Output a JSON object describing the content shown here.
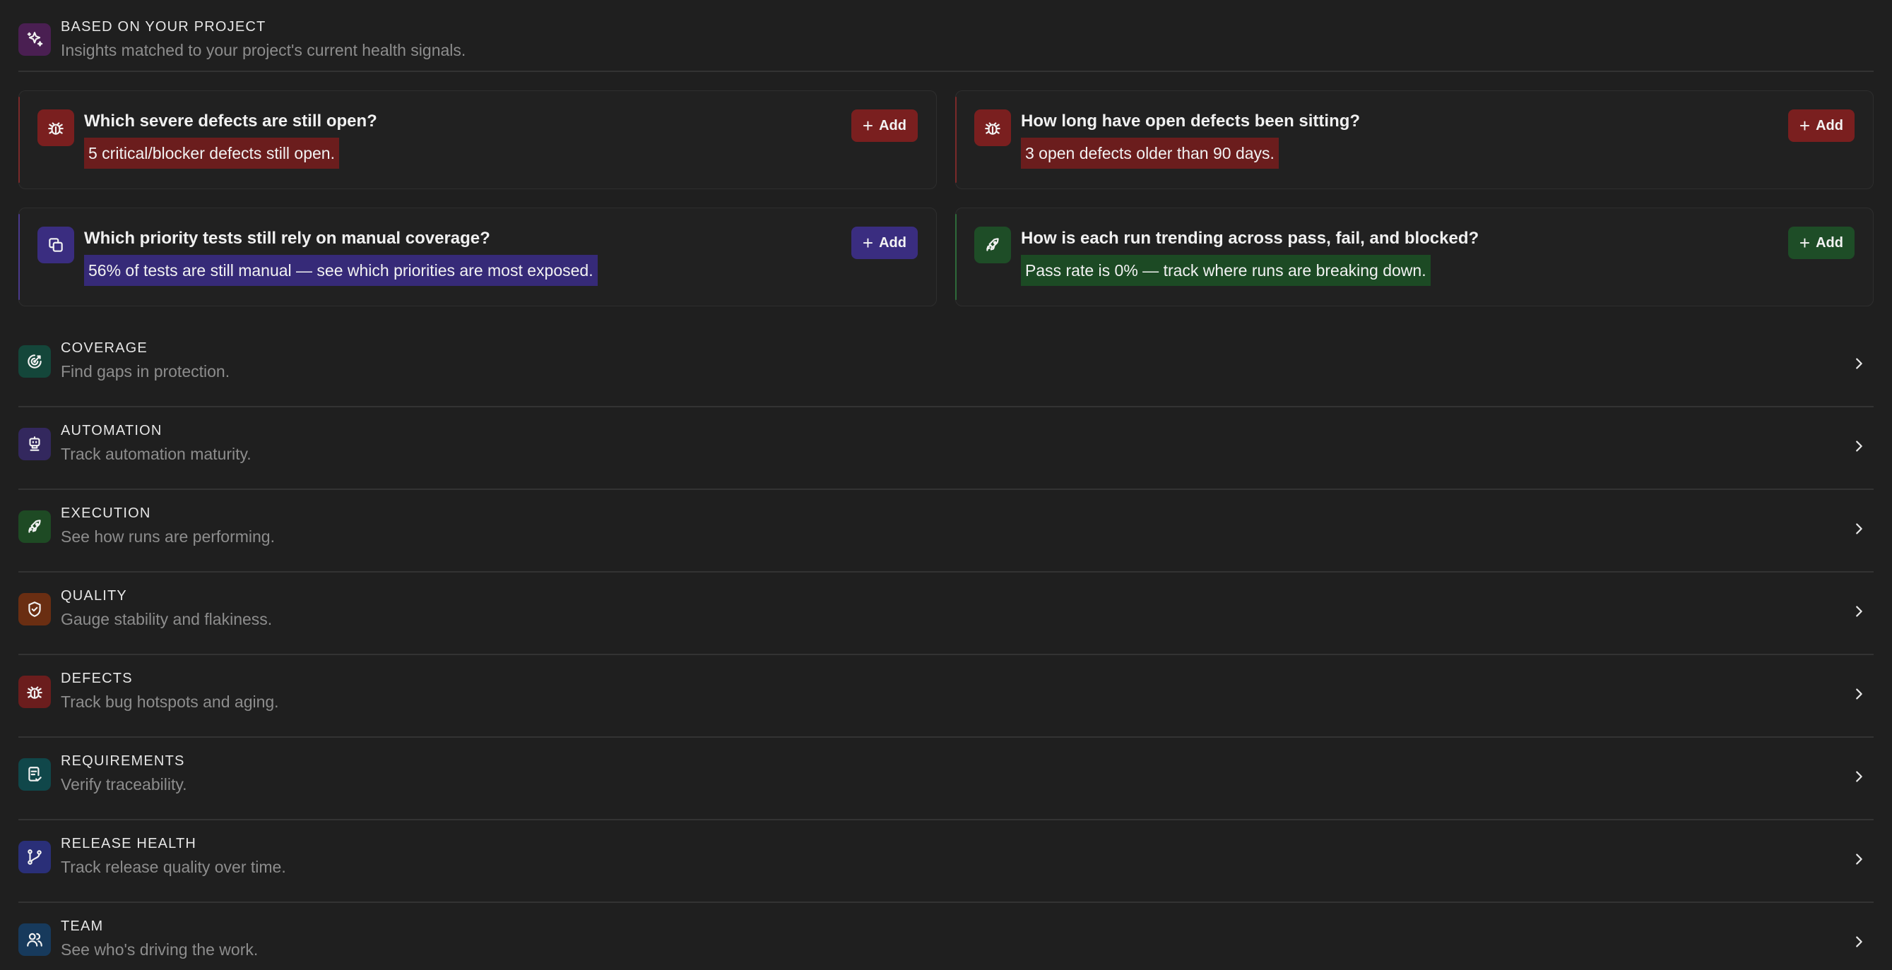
{
  "header": {
    "eyebrow": "BASED ON YOUR PROJECT",
    "subtitle": "Insights matched to your project's current health signals.",
    "icon": "sparkles-icon"
  },
  "cards": [
    {
      "title": "Which severe defects are still open?",
      "signal": "5 critical/blocker defects still open.",
      "button": "Add",
      "icon": "bug-icon",
      "tone": "red"
    },
    {
      "title": "How long have open defects been sitting?",
      "signal": "3 open defects older than 90 days.",
      "button": "Add",
      "icon": "bug-icon",
      "tone": "red"
    },
    {
      "title": "Which priority tests still rely on manual coverage?",
      "signal": "56% of tests are still manual — see which priorities are most exposed.",
      "button": "Add",
      "icon": "copy-icon",
      "tone": "purple"
    },
    {
      "title": "How is each run trending across pass, fail, and blocked?",
      "signal": "Pass rate is 0% — track where runs are breaking down.",
      "button": "Add",
      "icon": "rocket-icon",
      "tone": "green"
    }
  ],
  "categories": [
    {
      "title": "COVERAGE",
      "subtitle": "Find gaps in protection.",
      "icon": "target-icon"
    },
    {
      "title": "AUTOMATION",
      "subtitle": "Track automation maturity.",
      "icon": "robot-icon"
    },
    {
      "title": "EXECUTION",
      "subtitle": "See how runs are performing.",
      "icon": "rocket-icon"
    },
    {
      "title": "QUALITY",
      "subtitle": "Gauge stability and flakiness.",
      "icon": "shield-icon"
    },
    {
      "title": "DEFECTS",
      "subtitle": "Track bug hotspots and aging.",
      "icon": "bug-icon"
    },
    {
      "title": "REQUIREMENTS",
      "subtitle": "Verify traceability.",
      "icon": "clipboard-check-icon"
    },
    {
      "title": "RELEASE HEALTH",
      "subtitle": "Track release quality over time.",
      "icon": "git-branch-icon"
    },
    {
      "title": "TEAM",
      "subtitle": "See who's driving the work.",
      "icon": "users-icon"
    }
  ],
  "colors": {
    "background": "#1f1f1f",
    "red": "#6b1d1d",
    "purple": "#362a78",
    "green": "#1c4a24"
  }
}
